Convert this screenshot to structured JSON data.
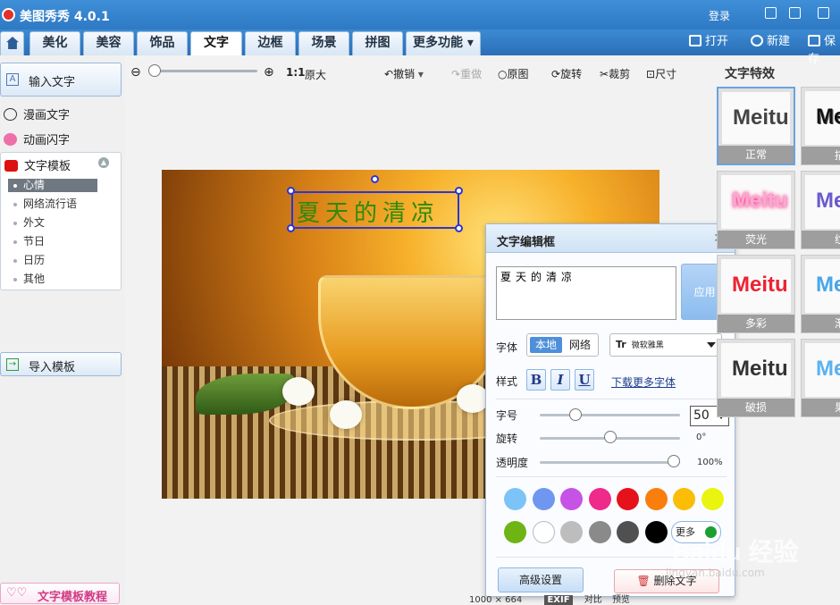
{
  "app": {
    "title": "美图秀秀 4.0.1",
    "login": "登录"
  },
  "tabs": [
    "美化",
    "美容",
    "饰品",
    "文字",
    "边框",
    "场景",
    "拼图",
    "更多功能"
  ],
  "active_tab": "文字",
  "top_actions": {
    "open": "打开",
    "new": "新建",
    "save": "保存"
  },
  "sidebar": {
    "input_text": "输入文字",
    "comic_text": "漫画文字",
    "animated_text": "动画闪字",
    "templates_title": "文字模板",
    "categories": [
      "心情",
      "网络流行语",
      "外文",
      "节日",
      "日历",
      "其他"
    ],
    "selected_category": "心情",
    "import_template": "导入模板",
    "tutorial": "文字模板教程"
  },
  "toolbar": {
    "zoom_actual": "原大",
    "zoom_ratio": "1:1",
    "undo": "撤销",
    "redo": "重做",
    "original": "原图",
    "rotate": "旋转",
    "crop": "裁剪",
    "size": "尺寸"
  },
  "canvas": {
    "overlay_text": "夏天的清凉"
  },
  "dialog": {
    "title": "文字编辑框",
    "text_value": "夏天的清凉",
    "apply": "应用",
    "font_label": "字体",
    "font_source_local": "本地",
    "font_source_web": "网络",
    "font_name": "微软雅黑",
    "style_label": "样式",
    "bold": "B",
    "italic": "I",
    "underline": "U",
    "download_fonts": "下载更多字体",
    "size_label": "字号",
    "size_value": "50",
    "rotate_label": "旋转",
    "rotate_value": "0°",
    "opacity_label": "透明度",
    "opacity_value": "100%",
    "more_colors": "更多",
    "advanced": "高级设置",
    "delete": "删除文字",
    "colors": [
      "#7cc4f8",
      "#6f97f2",
      "#c653e6",
      "#ee2a8a",
      "#e5121b",
      "#f97e0c",
      "#fbbd06",
      "#e9f50e",
      "#6db414",
      "#ffffff",
      "#bdbdbd",
      "#8a8a8a",
      "#505050",
      "#000000"
    ]
  },
  "effects": {
    "title": "文字特效",
    "items": [
      {
        "label": "正常",
        "sample": "Meitu"
      },
      {
        "label": "描",
        "sample": "Me"
      },
      {
        "label": "荧光",
        "sample": "Meitu"
      },
      {
        "label": "纹",
        "sample": "Me"
      },
      {
        "label": "多彩",
        "sample": "Meitu"
      },
      {
        "label": "渐",
        "sample": "Me"
      },
      {
        "label": "破损",
        "sample": "Meitu"
      },
      {
        "label": "果",
        "sample": "Me"
      }
    ]
  },
  "status": {
    "dimensions": "1000 × 664",
    "exif": "EXIF",
    "compare": "对比",
    "preview": "预览"
  },
  "watermark": {
    "brand": "Baidu 经验",
    "url": "jingyan.baidu.com"
  }
}
